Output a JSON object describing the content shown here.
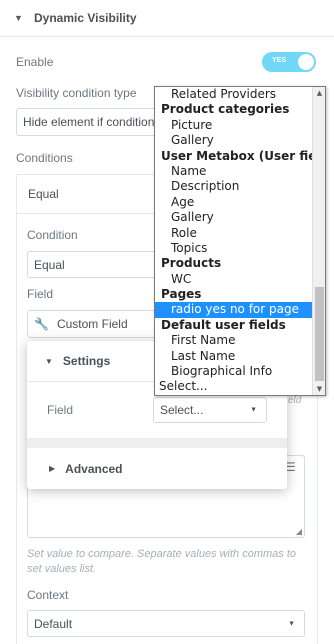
{
  "section": {
    "title": "Dynamic Visibility",
    "caret_icon": "caret-down-icon"
  },
  "enable": {
    "label": "Enable",
    "toggle_text": "YES",
    "on": true,
    "color": "#71d7f7"
  },
  "visibility_type": {
    "label": "Visibility condition type",
    "value": "Hide element if condition"
  },
  "conditions": {
    "label": "Conditions",
    "item_title": "Equal",
    "condition": {
      "label": "Condition",
      "value": "Equal"
    },
    "field": {
      "label": "Field",
      "value": "Custom Field",
      "icon": "wrench-icon"
    }
  },
  "popup": {
    "settings_title": "Settings",
    "field_label": "Field",
    "field_select_value": "Select...",
    "advanced_title": "Advanced"
  },
  "ghost_right_label": "eld",
  "note": "Set value to compare. Separate values with commas to set values list.",
  "context": {
    "label": "Context",
    "value": "Default"
  },
  "listbox": {
    "items": [
      {
        "type": "opt",
        "text": "Related Providers"
      },
      {
        "type": "grp",
        "text": "Product categories"
      },
      {
        "type": "opt",
        "text": "Picture"
      },
      {
        "type": "opt",
        "text": "Gallery"
      },
      {
        "type": "grp",
        "text": "User Metabox (User fields)"
      },
      {
        "type": "opt",
        "text": "Name"
      },
      {
        "type": "opt",
        "text": "Description"
      },
      {
        "type": "opt",
        "text": "Age"
      },
      {
        "type": "opt",
        "text": "Gallery"
      },
      {
        "type": "opt",
        "text": "Role"
      },
      {
        "type": "opt",
        "text": "Topics"
      },
      {
        "type": "grp",
        "text": "Products"
      },
      {
        "type": "opt",
        "text": "WC"
      },
      {
        "type": "grp",
        "text": "Pages"
      },
      {
        "type": "opt",
        "text": "radio yes no for page",
        "selected": true
      },
      {
        "type": "grp",
        "text": "Default user fields"
      },
      {
        "type": "opt",
        "text": "First Name"
      },
      {
        "type": "opt",
        "text": "Last Name"
      },
      {
        "type": "opt",
        "text": "Biographical Info"
      },
      {
        "type": "plain",
        "text": "Select..."
      }
    ],
    "selected_color": "#1e90ff"
  }
}
